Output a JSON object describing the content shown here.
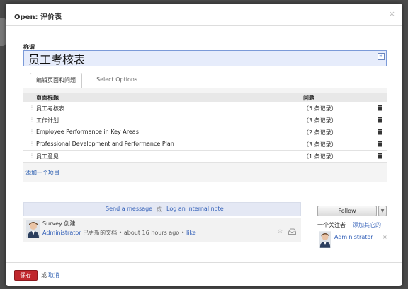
{
  "dialog": {
    "title": "Open: 评价表",
    "close": "×"
  },
  "name_field": {
    "label": "称谓",
    "value": "员工考核表"
  },
  "tabs": [
    {
      "label": "编辑页面和问题"
    },
    {
      "label": "Select Options"
    }
  ],
  "table": {
    "headers": [
      "页面标题",
      "问题"
    ],
    "rows": [
      {
        "title": "员工考核表",
        "count": "（5 条记录）"
      },
      {
        "title": "工作计划",
        "count": "（3 条记录）"
      },
      {
        "title": "Employee Performance in Key Areas",
        "count": "（2 条记录）"
      },
      {
        "title": "Professional Development and Performance Plan",
        "count": "（3 条记录）"
      },
      {
        "title": "员工意见",
        "count": "（1 条记录）"
      }
    ],
    "add_item": "添加一个项目"
  },
  "chatter": {
    "send_message": "Send a message",
    "or": "或",
    "log_note": "Log an internal note",
    "message": {
      "subject": "Survey 创建",
      "author": "Administrator",
      "action": "已更新的文档",
      "time": "about 16 hours ago",
      "like": "like"
    }
  },
  "followers": {
    "follow_label": "Follow",
    "count_text": "一个关注者",
    "add_other": "添加其它的",
    "items": [
      {
        "name": "Administrator",
        "remove": "×"
      }
    ]
  },
  "footer": {
    "save": "保存",
    "or": "或",
    "cancel": "取消"
  },
  "colors": {
    "save_button": "#c0272d",
    "link": "#2a5db0",
    "input_bg": "#e6ecfb"
  }
}
